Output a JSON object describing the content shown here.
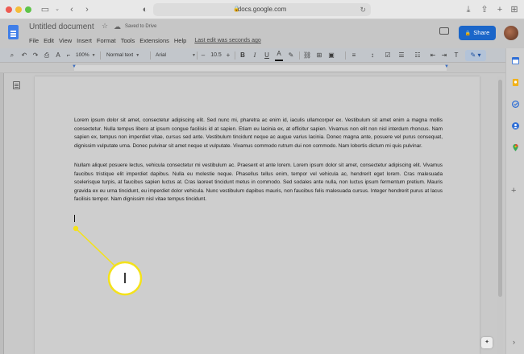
{
  "browser": {
    "url": "docs.google.com",
    "icons": [
      "sidebar-icon",
      "back-icon",
      "forward-icon",
      "shield-icon",
      "lock-icon",
      "reload-icon",
      "download-icon",
      "share-icon",
      "new-tab-icon",
      "tab-overview-icon"
    ]
  },
  "header": {
    "title": "Untitled document",
    "saved_status": "Saved to Drive",
    "menus": [
      "File",
      "Edit",
      "View",
      "Insert",
      "Format",
      "Tools",
      "Extensions",
      "Help"
    ],
    "last_edit": "Last edit was seconds ago",
    "share_label": "Share",
    "share_color": "#1b66c9"
  },
  "toolbar": {
    "zoom": "100%",
    "style": "Normal text",
    "font": "Arial",
    "font_size": "10.5",
    "minus": "–",
    "plus": "+",
    "bold": "B",
    "italic": "I",
    "underline": "U",
    "text_color": "A"
  },
  "document": {
    "paragraphs": [
      "Lorem ipsum dolor sit amet, consectetur adipiscing elit. Sed nunc mi, pharetra ac enim id, iaculis ullamcorper ex. Vestibulum sit amet enim a magna mollis consectetur. Nulla tempus libero at ipsum congue facilisis id at sapien. Etiam eu lacinia ex, at efficitur sapien. Vivamus non elit non nisl interdum rhoncus. Nam sapien ex, tempus non imperdiet vitae, cursus sed ante. Vestibulum tincidunt neque ac augue varius lacinia. Donec magna ante, posuere vel purus consequat, dignissim vulputate urna. Donec pulvinar sit amet neque ut vulputate. Vivamus commodo rutrum dui non commodo. Nam lobortis dictum mi quis pulvinar.",
      "Nullam aliquet posuere lectus, vehicula consectetur mi vestibulum ac. Praesent et ante lorem. Lorem ipsum dolor sit amet, consectetur adipiscing elit. Vivamus faucibus tristique elit imperdiet dapibus. Nulla eu molestie neque. Phasellus tellus enim, tempor vel vehicula ac, hendrerit eget lorem. Cras malesuada scelerisque turpis, at faucibus sapien luctus at. Cras laoreet tincidunt metus in commodo. Sed sodales ante nulla, non luctus ipsum fermentum pretium. Mauris gravida ex eu urna tincidunt, eu imperdiet dolor vehicula. Nunc vestibulum dapibus mauris, non faucibus felis malesuada cursus. Integer hendrerit purus at lacus facilisis tempor. Nam dignissim nisl vitae tempus tincidunt."
    ]
  },
  "callout": {
    "label": "I",
    "color": "#f4e21a"
  },
  "side_panel": {
    "icons": [
      "calendar-icon",
      "keep-icon",
      "tasks-icon",
      "contacts-icon",
      "maps-icon"
    ]
  }
}
